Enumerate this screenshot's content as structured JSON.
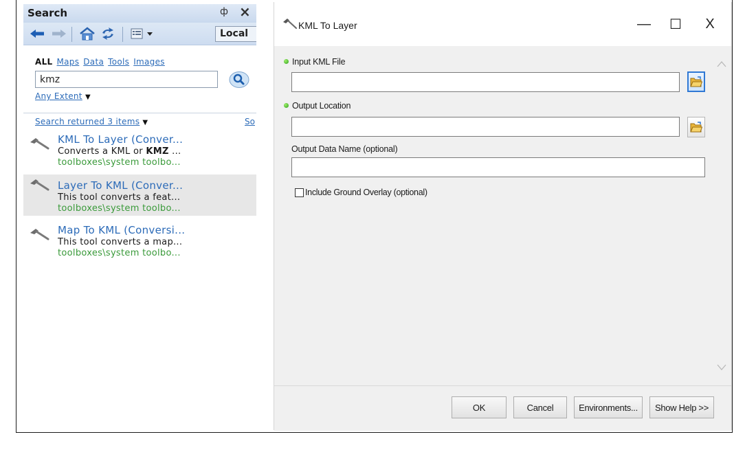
{
  "search_pane": {
    "title": "Search",
    "pin_glyph": "ф",
    "close_glyph": "×",
    "scope_label": "Local",
    "filters": {
      "all": "ALL",
      "maps": "Maps",
      "data": "Data",
      "tools": "Tools",
      "images": "Images"
    },
    "query": "kmz",
    "extent_label": "Any Extent",
    "results_summary": "Search returned 3 items",
    "sort_label": "So",
    "results": [
      {
        "title": "KML To Layer (Conver...",
        "desc_pre": "Converts a KML or ",
        "desc_bold": "KMZ",
        "desc_post": " ...",
        "path": "toolboxes\\system toolbo...",
        "selected": false
      },
      {
        "title": "Layer To KML (Conver...",
        "desc_pre": "This tool converts a feat...",
        "desc_bold": "",
        "desc_post": "",
        "path": "toolboxes\\system toolbo...",
        "selected": true
      },
      {
        "title": "Map To KML (Conversi...",
        "desc_pre": "This tool converts a map...",
        "desc_bold": "",
        "desc_post": "",
        "path": "toolboxes\\system toolbo...",
        "selected": false
      }
    ]
  },
  "dialog": {
    "title": "KML To Layer",
    "minimize_glyph": "—",
    "maximize_glyph": "☐",
    "close_glyph": "X",
    "params": {
      "input_kml": {
        "label": "Input KML File",
        "value": ""
      },
      "output_location": {
        "label": "Output Location",
        "value": ""
      },
      "output_name": {
        "label": "Output Data Name (optional)",
        "value": ""
      },
      "ground_overlay": {
        "label": "Include Ground Overlay (optional)",
        "checked": false
      }
    },
    "buttons": {
      "ok": "OK",
      "cancel": "Cancel",
      "environments": "Environments...",
      "help": "Show Help >>"
    }
  },
  "colors": {
    "link": "#2c6bb8",
    "path_green": "#3a9a3a",
    "required_dot": "#2c9d1c",
    "active_border": "#2f78d4"
  }
}
